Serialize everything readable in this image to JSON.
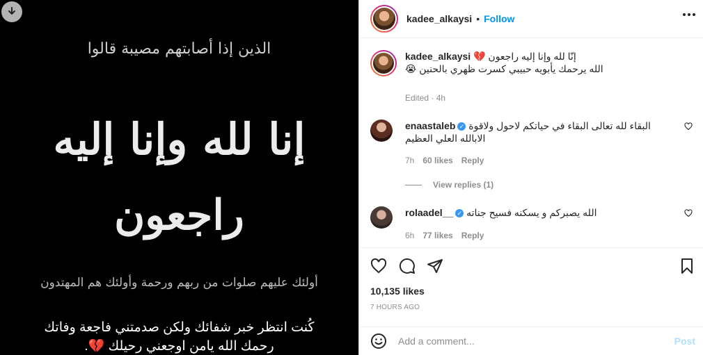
{
  "media": {
    "download_icon": "download-icon",
    "calligraphy_top": "الذين إذا أصابتهم مصيبة قالوا",
    "calligraphy_main_1": "إنا لله وإنا إليه",
    "calligraphy_main_2": "راجعون",
    "calligraphy_bottom": "أولئك عليهم صلوات من ربهم ورحمة وأولئك هم المهتدون",
    "caption_line1": "كُنت انتظر خبر شفائك ولكن صدمتني فاجعة وفاتك",
    "caption_line2": "رحمك الله يامن اوجعني رحيلك 💔."
  },
  "header": {
    "username": "kadee_alkaysi",
    "separator": "•",
    "follow_label": "Follow",
    "more_icon": "more-options-icon"
  },
  "post_caption": {
    "username": "kadee_alkaysi",
    "line1": "إنّا لله وإنا إليه راجعون 💔",
    "line2": "الله يرحمك يأبويه حبيبي كسرت ظهري بالحنين 😭",
    "edited": "Edited · 4h"
  },
  "comments": [
    {
      "username": "enaastaleb",
      "verified": true,
      "text": "البقاء لله تعالى البقاء في حياتكم لاحول ولاقوة الابالله العلي العظيم",
      "time": "7h",
      "likes": "60 likes",
      "reply_label": "Reply",
      "view_replies": "View replies (1)"
    },
    {
      "username": "rolaadel__",
      "verified": true,
      "text": "الله يصبركم و يسكنه فسيح جناته",
      "time": "6h",
      "likes": "77 likes",
      "reply_label": "Reply"
    }
  ],
  "actions": {
    "like_icon": "heart-icon",
    "comment_icon": "comment-icon",
    "share_icon": "share-icon",
    "save_icon": "bookmark-icon"
  },
  "likes_count": "10,135 likes",
  "time_ago": "7 HOURS AGO",
  "add_comment": {
    "emoji_icon": "emoji-icon",
    "placeholder": "Add a comment...",
    "post_label": "Post"
  }
}
